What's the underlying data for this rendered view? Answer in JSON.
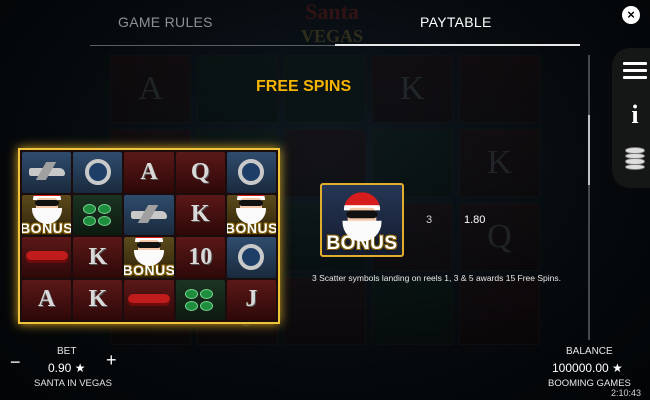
{
  "tabs": {
    "rules": "GAME RULES",
    "paytable": "PAYTABLE"
  },
  "close_icon": "×",
  "background_logo": {
    "line1": "Santa",
    "line2": "VEGAS"
  },
  "section_title": "FREE SPINS",
  "reels": [
    [
      "jet",
      "watch",
      "A",
      "Q",
      "watch"
    ],
    [
      "BONUS",
      "chips",
      "jet",
      "K",
      "BONUS"
    ],
    [
      "limo",
      "K",
      "BONUS",
      "10",
      "watch"
    ],
    [
      "A",
      "K",
      "limo",
      "chips",
      "J"
    ]
  ],
  "scatter": {
    "symbol_label": "BONUS",
    "count": "3",
    "value": "1.80",
    "description": "3 Scatter symbols landing on reels 1, 3 & 5 awards 15 Free Spins."
  },
  "side_menu": [
    "hamburger-icon",
    "info-icon",
    "coins-icon"
  ],
  "bet": {
    "label": "BET",
    "value": "0.90 ★",
    "minus": "−",
    "plus": "+"
  },
  "game_name": "SANTA IN VEGAS",
  "balance": {
    "label": "BALANCE",
    "value": "100000.00 ★"
  },
  "brand": "BOOMING GAMES",
  "clock": "2:10:43",
  "colors": {
    "accent": "#f5b400",
    "reel_border": "#f0c43a",
    "panel": "#1b0d0d"
  }
}
